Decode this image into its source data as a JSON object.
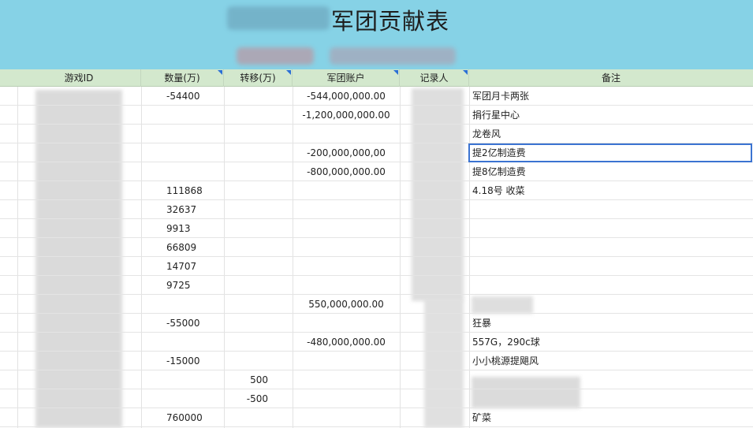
{
  "title": "军团贡献表",
  "headers": {
    "game_id": "游戏ID",
    "quantity": "数量(万)",
    "transfer": "转移(万)",
    "account": "军团账户",
    "recorder": "记录人",
    "notes": "备注"
  },
  "rows": [
    {
      "qty": "-54400",
      "transfer": "",
      "account": "-544,000,000.00",
      "note": "军团月卡两张"
    },
    {
      "qty": "",
      "transfer": "",
      "account": "-1,200,000,000.00",
      "note": "捐行星中心"
    },
    {
      "qty": "",
      "transfer": "",
      "account": "",
      "note": "龙卷风"
    },
    {
      "qty": "",
      "transfer": "",
      "account": "-200,000,000,00",
      "note": "提2亿制造费"
    },
    {
      "qty": "",
      "transfer": "",
      "account": "-800,000,000.00",
      "note": "提8亿制造费"
    },
    {
      "qty": "111868",
      "transfer": "",
      "account": "",
      "note": "4.18号 收菜"
    },
    {
      "qty": "32637",
      "transfer": "",
      "account": "",
      "note": ""
    },
    {
      "qty": "9913",
      "transfer": "",
      "account": "",
      "note": ""
    },
    {
      "qty": "66809",
      "transfer": "",
      "account": "",
      "note": ""
    },
    {
      "qty": "14707",
      "transfer": "",
      "account": "",
      "note": ""
    },
    {
      "qty": "9725",
      "transfer": "",
      "account": "",
      "note": ""
    },
    {
      "qty": "",
      "transfer": "",
      "account": "550,000,000.00",
      "note": ""
    },
    {
      "qty": "-55000",
      "transfer": "",
      "account": "",
      "note": "狂暴"
    },
    {
      "qty": "",
      "transfer": "",
      "account": "-480,000,000.00",
      "note": "557G，290c球"
    },
    {
      "qty": "-15000",
      "transfer": "",
      "account": "",
      "note": "小小桃源提飓风"
    },
    {
      "qty": "",
      "transfer": "500",
      "account": "",
      "note": ""
    },
    {
      "qty": "",
      "transfer": "-500",
      "account": "",
      "note": ""
    },
    {
      "qty": "760000",
      "transfer": "",
      "account": "",
      "note": "矿菜"
    }
  ],
  "colors": {
    "banner": "#86d2e6",
    "header": "#d3e8cd",
    "selection": "#3b73d1",
    "filter_marker": "#2a6fd6"
  }
}
